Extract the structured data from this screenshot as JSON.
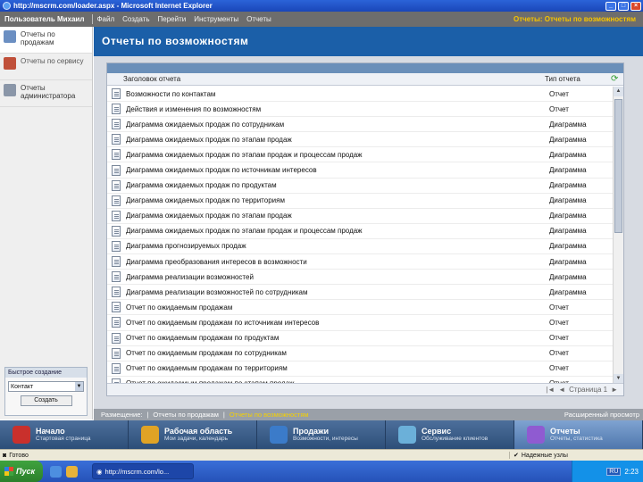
{
  "window": {
    "title": "http://mscrm.com/loader.aspx - Microsoft Internet Explorer"
  },
  "appbar": {
    "user": "Пользователь Михаил",
    "menu": [
      "Файл",
      "Создать",
      "Перейти",
      "Инструменты",
      "Отчеты"
    ],
    "breadcrumb": "Отчеты: Отчеты по возможностям"
  },
  "leftnav": {
    "items": [
      {
        "label": "Отчеты по продажам"
      },
      {
        "label": "Отчеты по сервису"
      },
      {
        "label": "Отчеты администратора"
      }
    ]
  },
  "quick_create": {
    "title": "Быстрое создание",
    "selected": "Контакт",
    "button": "Создать"
  },
  "page": {
    "title": "Отчеты по возможностям"
  },
  "grid": {
    "col_title": "Заголовок отчета",
    "col_type": "Тип отчета",
    "rows": [
      {
        "title": "Возможности по контактам",
        "type": "Отчет"
      },
      {
        "title": "Действия и изменения по возможностям",
        "type": "Отчет"
      },
      {
        "title": "Диаграмма ожидаемых продаж по сотрудникам",
        "type": "Диаграмма"
      },
      {
        "title": "Диаграмма ожидаемых продаж по этапам продаж",
        "type": "Диаграмма"
      },
      {
        "title": "Диаграмма ожидаемых продаж по этапам продаж и процессам продаж",
        "type": "Диаграмма"
      },
      {
        "title": "Диаграмма ожидаемых продаж по источникам интересов",
        "type": "Диаграмма"
      },
      {
        "title": "Диаграмма ожидаемых продаж по продуктам",
        "type": "Диаграмма"
      },
      {
        "title": "Диаграмма ожидаемых продаж по территориям",
        "type": "Диаграмма"
      },
      {
        "title": "Диаграмма ожидаемых продаж по этапам продаж",
        "type": "Диаграмма"
      },
      {
        "title": "Диаграмма ожидаемых продаж по этапам продаж и процессам продаж",
        "type": "Диаграмма"
      },
      {
        "title": "Диаграмма прогнозируемых продаж",
        "type": "Диаграмма"
      },
      {
        "title": "Диаграмма преобразования интересов в возможности",
        "type": "Диаграмма"
      },
      {
        "title": "Диаграмма реализации возможностей",
        "type": "Диаграмма"
      },
      {
        "title": "Диаграмма реализации возможностей по сотрудникам",
        "type": "Диаграмма"
      },
      {
        "title": "Отчет по ожидаемым продажам",
        "type": "Отчет"
      },
      {
        "title": "Отчет по ожидаемым продажам по источникам интересов",
        "type": "Отчет"
      },
      {
        "title": "Отчет по ожидаемым продажам по продуктам",
        "type": "Отчет"
      },
      {
        "title": "Отчет по ожидаемым продажам по сотрудникам",
        "type": "Отчет"
      },
      {
        "title": "Отчет по ожидаемым продажам по территориям",
        "type": "Отчет"
      },
      {
        "title": "Отчет по ожидаемым продажам по этапам продаж",
        "type": "Отчет"
      }
    ],
    "footer_page": "Страница 1"
  },
  "bottombar": {
    "prefix": "Размещение:",
    "items": [
      "Отчеты по продажам",
      "Отчеты по возможностям"
    ],
    "advanced": "Расширенный просмотр"
  },
  "modules": [
    {
      "title": "Начало",
      "sub": "Стартовая страница",
      "color": "#c9302c"
    },
    {
      "title": "Рабочая область",
      "sub": "Мои задачи, календарь",
      "color": "#e0a325"
    },
    {
      "title": "Продажи",
      "sub": "Возможности, интересы",
      "color": "#3b7bc9"
    },
    {
      "title": "Сервис",
      "sub": "Обслуживание клиентов",
      "color": "#6bb0d9"
    },
    {
      "title": "Отчеты",
      "sub": "Отчеты, статистика",
      "color": "#8f5bd1"
    }
  ],
  "statusbar": {
    "done": "Готово",
    "zone": "Надежные узлы"
  },
  "taskbar": {
    "start": "Пуск",
    "task": "http://mscrm.com/lo...",
    "lang": "RU",
    "clock": "2:23"
  }
}
